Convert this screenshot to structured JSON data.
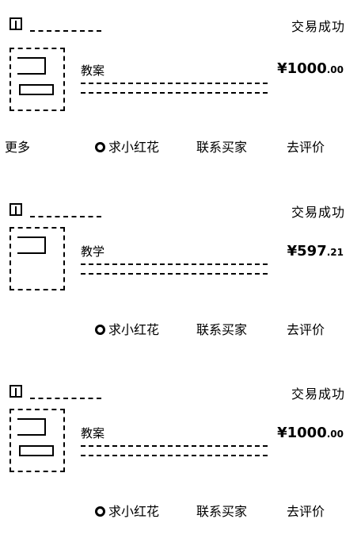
{
  "orders": [
    {
      "status": "交易成功",
      "title_prefix": "教案",
      "price_main": "¥1000",
      "price_decimal": ".00",
      "more_label": "更多",
      "flower_label": "求小红花",
      "contact_label": "联系买家",
      "review_label": "去评价"
    },
    {
      "status": "交易成功",
      "title_prefix": "教学",
      "price_main": "¥597",
      "price_decimal": ".21",
      "flower_label": "求小红花",
      "contact_label": "联系买家",
      "review_label": "去评价"
    },
    {
      "status": "交易成功",
      "title_prefix": "教案",
      "price_main": "¥1000",
      "price_decimal": ".00",
      "flower_label": "求小红花",
      "contact_label": "联系买家",
      "review_label": "去评价"
    }
  ]
}
